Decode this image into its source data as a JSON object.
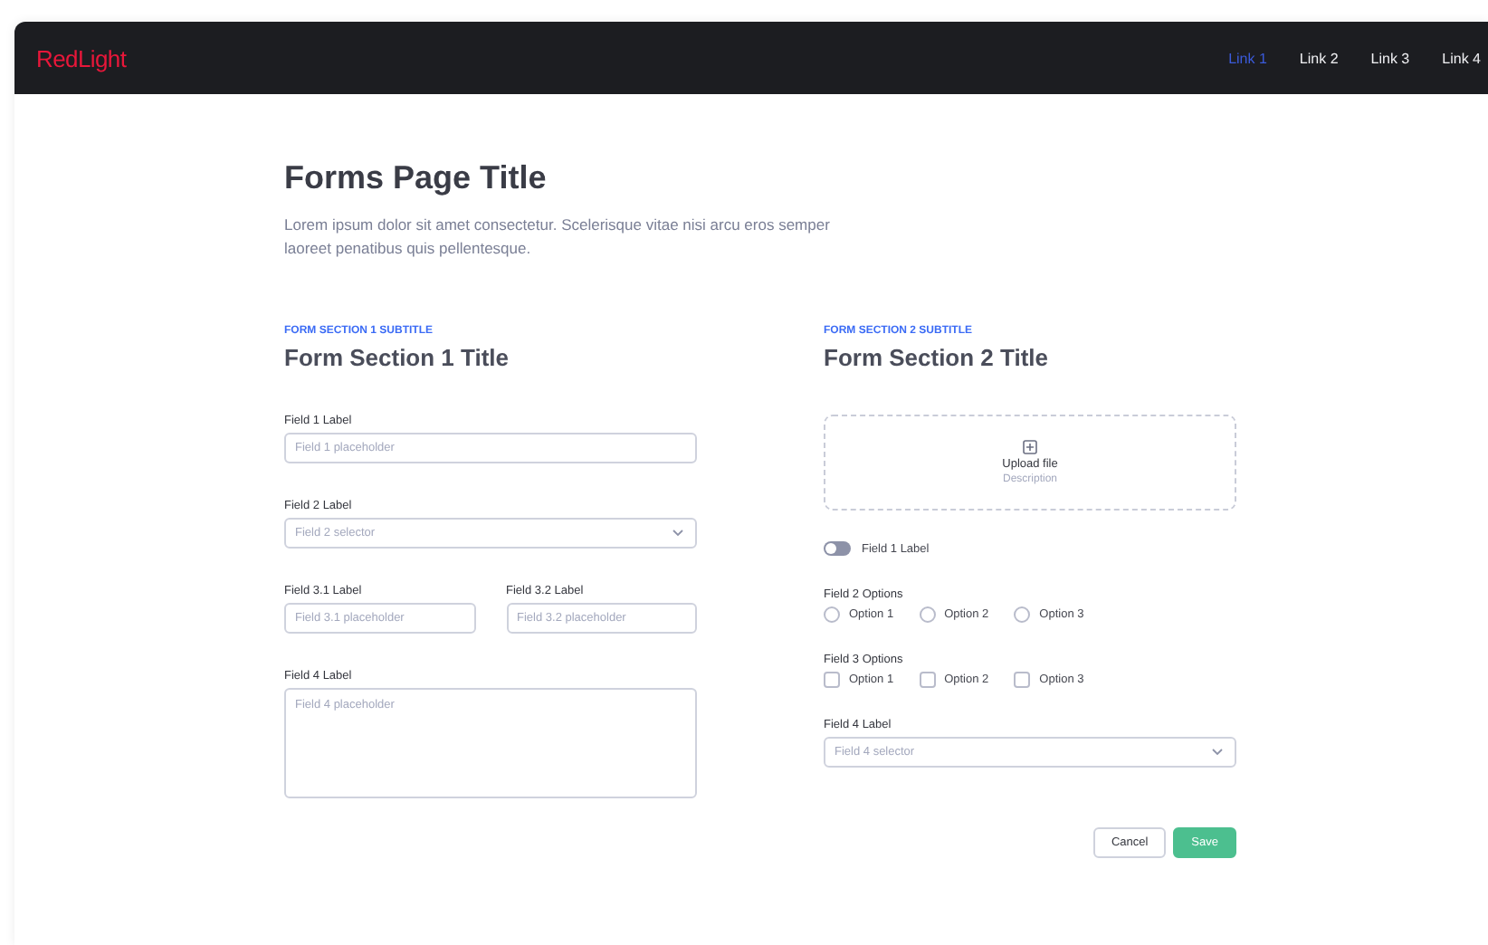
{
  "navbar": {
    "logo": "RedLight",
    "links": [
      {
        "label": "Link 1",
        "selected": true
      },
      {
        "label": "Link 2",
        "selected": false
      },
      {
        "label": "Link 3",
        "selected": false
      },
      {
        "label": "Link 4",
        "selected": false
      }
    ]
  },
  "page": {
    "title": "Forms Page Title",
    "description": "Lorem ipsum dolor sit amet consectetur. Scelerisque vitae nisi arcu eros semper laoreet penatibus quis pellentesque."
  },
  "section_1": {
    "subtitle": "FORM SECTION 1 SUBTITLE",
    "title": "Form Section 1 Title",
    "field_1": {
      "label": "Field 1 Label",
      "placeholder": "Field 1 placeholder"
    },
    "field_2": {
      "label": "Field 2 Label",
      "placeholder": "Field 2 selector"
    },
    "field_3": [
      {
        "label": "Field 3.1 Label",
        "placeholder": "Field 3.1 placeholder"
      },
      {
        "label": "Field 3.2 Label",
        "placeholder": "Field 3.2 placeholder"
      }
    ],
    "field_4": {
      "label": "Field 4 Label",
      "placeholder": "Field 4 placeholder"
    }
  },
  "section_2": {
    "subtitle": "FORM SECTION 2 SUBTITLE",
    "title": "Form Section 2 Title",
    "upload": {
      "title": "Upload file",
      "description": "Description"
    },
    "toggle": {
      "label": "Field 1 Label",
      "on": false
    },
    "field_2": {
      "label": "Field 2 Options",
      "options": [
        {
          "label": "Option 1",
          "selected": false
        },
        {
          "label": "Option 2",
          "selected": false
        },
        {
          "label": "Option 3",
          "selected": false
        }
      ]
    },
    "field_3": {
      "label": "Field 3 Options",
      "options": [
        {
          "label": "Option 1",
          "checked": false
        },
        {
          "label": "Option 2",
          "checked": false
        },
        {
          "label": "Option 3",
          "checked": false
        }
      ]
    },
    "field_4": {
      "label": "Field 4 Label",
      "placeholder": "Field 4 selector"
    }
  },
  "buttons": {
    "cancel": "Cancel",
    "save": "Save"
  }
}
